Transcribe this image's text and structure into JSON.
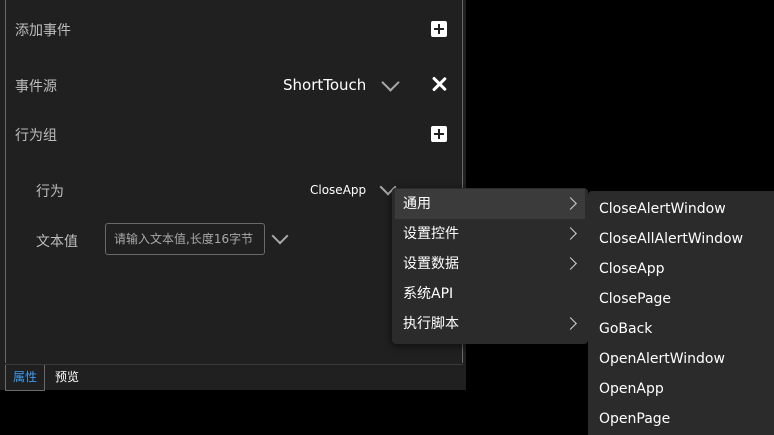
{
  "properties": {
    "add_event": {
      "label": "添加事件"
    },
    "event_source": {
      "label": "事件源",
      "value": "ShortTouch"
    },
    "action_group": {
      "label": "行为组"
    },
    "action": {
      "label": "行为",
      "value": "CloseApp"
    },
    "text_value": {
      "label": "文本值",
      "placeholder": "请输入文本值,长度16字节"
    }
  },
  "tabs": [
    {
      "label": "属性",
      "active": true
    },
    {
      "label": "预览",
      "active": false
    }
  ],
  "context_menu": {
    "items": [
      {
        "label": "通用",
        "has_submenu": true,
        "highlighted": true
      },
      {
        "label": "设置控件",
        "has_submenu": true
      },
      {
        "label": "设置数据",
        "has_submenu": true
      },
      {
        "label": "系统API",
        "has_submenu": false
      },
      {
        "label": "执行脚本",
        "has_submenu": true
      }
    ]
  },
  "submenu": {
    "items": [
      "CloseAlertWindow",
      "CloseAllAlertWindow",
      "CloseApp",
      "ClosePage",
      "GoBack",
      "OpenAlertWindow",
      "OpenApp",
      "OpenPage"
    ]
  },
  "colors": {
    "panel_bg": "#202020",
    "menu_bg": "#2b2b2b",
    "active_tab": "#3c9bf2"
  }
}
